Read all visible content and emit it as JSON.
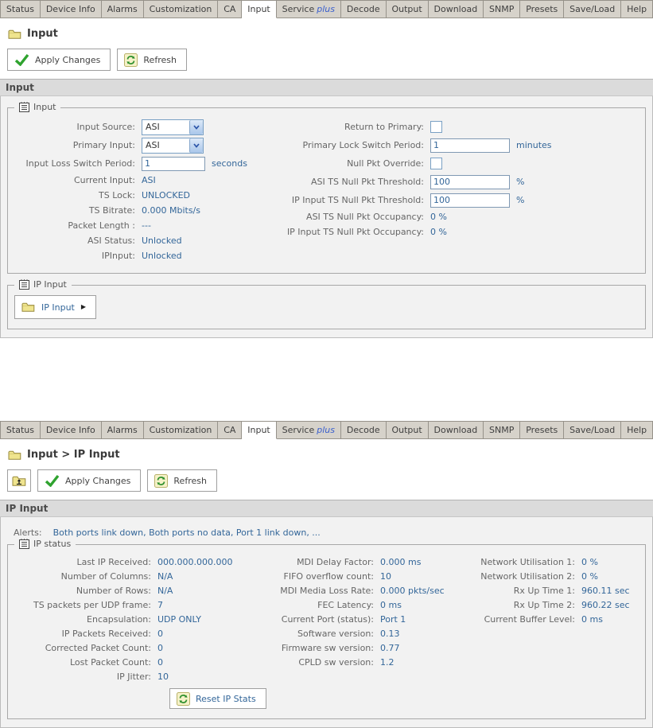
{
  "colors": {
    "value_blue": "#336699",
    "label_gray": "#666666",
    "tab_bg": "#d6d2ca",
    "active_tab_bg": "#ffffff",
    "header_bar_bg": "#dbdbdb",
    "content_bg": "#f2f2f2",
    "check_green": "#2fa32f",
    "folder_yellow": "#efe48e",
    "plus_blue": "#3a5fcd"
  },
  "icons": {
    "breadcrumb": "folder-icon",
    "apply": "check-icon",
    "refresh": "refresh-icon",
    "up": "folder-up-icon",
    "legend": "notes-icon",
    "nav_arrow": "play-icon",
    "select_arrow": "chevron-down-icon"
  },
  "tabs": {
    "active": "Input",
    "items": [
      {
        "label": "Status"
      },
      {
        "label": "Device Info"
      },
      {
        "label": "Alarms"
      },
      {
        "label": "Customization"
      },
      {
        "label": "CA"
      },
      {
        "label": "Input"
      },
      {
        "label": "Service",
        "suffix": "plus"
      },
      {
        "label": "Decode"
      },
      {
        "label": "Output"
      },
      {
        "label": "Download"
      },
      {
        "label": "SNMP"
      },
      {
        "label": "Presets"
      },
      {
        "label": "Save/Load"
      },
      {
        "label": "Help"
      }
    ]
  },
  "toolbar": {
    "apply": "Apply Changes",
    "refresh": "Refresh"
  },
  "panels": [
    {
      "breadcrumb": "Input",
      "section_header": "Input",
      "fieldsets": [
        {
          "legend": "Input",
          "columns": [
            {
              "rows": [
                {
                  "label": "Input Source:",
                  "type": "select",
                  "value": "ASI"
                },
                {
                  "label": "Primary Input:",
                  "type": "select",
                  "value": "ASI"
                },
                {
                  "label": "Input Loss Switch Period:",
                  "type": "text",
                  "value": "1",
                  "suffix": "seconds"
                },
                {
                  "label": "Current Input:",
                  "type": "static",
                  "value": "ASI"
                },
                {
                  "label": "TS Lock:",
                  "type": "static",
                  "value": "UNLOCKED"
                },
                {
                  "label": "TS Bitrate:",
                  "type": "static",
                  "value": "0.000 Mbits/s"
                },
                {
                  "label": "Packet Length :",
                  "type": "static",
                  "value": "---"
                },
                {
                  "label": "ASI Status:",
                  "type": "static",
                  "value": "Unlocked"
                },
                {
                  "label": "IPInput:",
                  "type": "static",
                  "value": "Unlocked"
                }
              ]
            },
            {
              "rows": [
                {
                  "label": "Return to Primary:",
                  "type": "checkbox",
                  "checked": false
                },
                {
                  "label": "Primary Lock Switch Period:",
                  "type": "text",
                  "value": "1",
                  "suffix": "minutes"
                },
                {
                  "label": "Null Pkt Override:",
                  "type": "checkbox",
                  "checked": false
                },
                {
                  "label": "ASI TS Null Pkt Threshold:",
                  "type": "text",
                  "value": "100",
                  "suffix": "%"
                },
                {
                  "label": "IP Input TS Null Pkt Threshold:",
                  "type": "text",
                  "value": "100",
                  "suffix": "%"
                },
                {
                  "label": "ASI TS Null Pkt Occupancy:",
                  "type": "static",
                  "value": "0 %"
                },
                {
                  "label": "IP Input TS Null Pkt Occupancy:",
                  "type": "static",
                  "value": "0 %"
                }
              ]
            }
          ]
        },
        {
          "legend": "IP Input",
          "nav_button": {
            "label": "IP Input"
          }
        }
      ]
    },
    {
      "breadcrumb": "Input > IP Input",
      "section_header": "IP Input",
      "alerts": {
        "label": "Alerts:",
        "text": "Both ports link down, Both ports no data, Port 1 link down, ..."
      },
      "fieldsets": [
        {
          "legend": "IP status",
          "columns": [
            {
              "rows": [
                {
                  "label": "Last IP Received:",
                  "type": "static",
                  "value": "000.000.000.000"
                },
                {
                  "label": "Number of Columns:",
                  "type": "static",
                  "value": "N/A"
                },
                {
                  "label": "Number of Rows:",
                  "type": "static",
                  "value": "N/A"
                },
                {
                  "label": "TS packets per UDP frame:",
                  "type": "static",
                  "value": "7"
                },
                {
                  "label": "Encapsulation:",
                  "type": "static",
                  "value": "UDP ONLY"
                },
                {
                  "label": "IP Packets Received:",
                  "type": "static",
                  "value": "0"
                },
                {
                  "label": "Corrected Packet Count:",
                  "type": "static",
                  "value": "0"
                },
                {
                  "label": "Lost Packet Count:",
                  "type": "static",
                  "value": "0"
                },
                {
                  "label": "IP Jitter:",
                  "type": "static",
                  "value": "10"
                }
              ]
            },
            {
              "rows": [
                {
                  "label": "MDI Delay Factor:",
                  "type": "static",
                  "value": "0.000 ms"
                },
                {
                  "label": "FIFO overflow count:",
                  "type": "static",
                  "value": "10"
                },
                {
                  "label": "MDI Media Loss Rate:",
                  "type": "static",
                  "value": "0.000 pkts/sec"
                },
                {
                  "label": "FEC Latency:",
                  "type": "static",
                  "value": "0 ms"
                },
                {
                  "label": "Current Port (status):",
                  "type": "static",
                  "value": "Port 1"
                },
                {
                  "label": "Software version:",
                  "type": "static",
                  "value": "0.13"
                },
                {
                  "label": "Firmware sw version:",
                  "type": "static",
                  "value": "0.77"
                },
                {
                  "label": "CPLD sw version:",
                  "type": "static",
                  "value": "1.2"
                }
              ]
            },
            {
              "rows": [
                {
                  "label": "Network Utilisation 1:",
                  "type": "static",
                  "value": "0 %"
                },
                {
                  "label": "Network Utilisation 2:",
                  "type": "static",
                  "value": "0 %"
                },
                {
                  "label": "Rx Up Time 1:",
                  "type": "static",
                  "value": "960.11 sec"
                },
                {
                  "label": "Rx Up Time 2:",
                  "type": "static",
                  "value": "960.22 sec"
                },
                {
                  "label": "Current Buffer Level:",
                  "type": "static",
                  "value": "0 ms"
                }
              ]
            }
          ],
          "footer_button": {
            "label": "Reset IP Stats"
          }
        }
      ]
    }
  ]
}
